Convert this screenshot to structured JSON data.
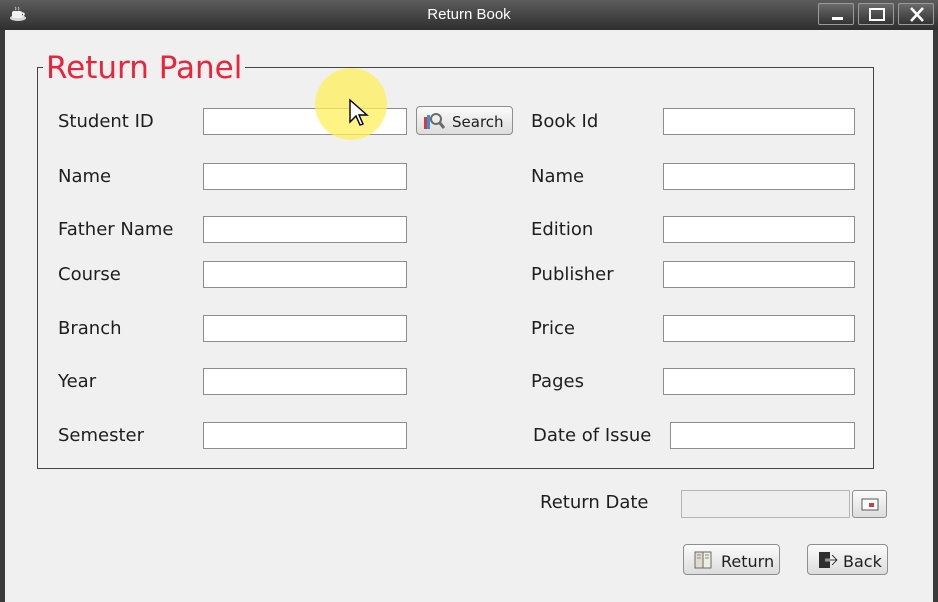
{
  "window": {
    "title": "Return Book"
  },
  "panel": {
    "title": "Return Panel"
  },
  "student": {
    "id_label": "Student ID",
    "id_value": "",
    "search_label": "Search",
    "name_label": "Name",
    "father_name_label": "Father Name",
    "course_label": "Course",
    "branch_label": "Branch",
    "year_label": "Year",
    "semester_label": "Semester"
  },
  "book": {
    "id_label": "Book Id",
    "name_label": "Name",
    "edition_label": "Edition",
    "publisher_label": "Publisher",
    "price_label": "Price",
    "pages_label": "Pages",
    "date_of_issue_label": "Date of Issue"
  },
  "footer": {
    "return_date_label": "Return Date",
    "return_button": "Return",
    "back_button": "Back"
  },
  "colors": {
    "panel_title": "#e8253b",
    "titlebar": "#3c3c3c",
    "client_bg": "#f0f0f0"
  }
}
